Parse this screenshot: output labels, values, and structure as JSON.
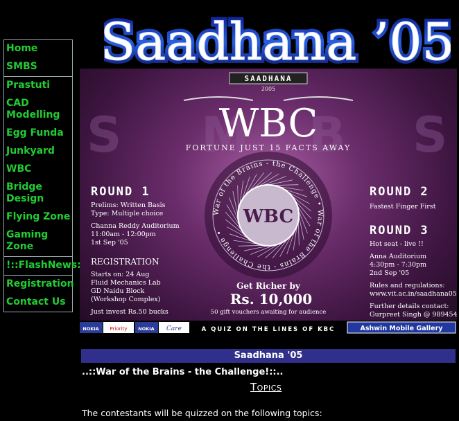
{
  "site": {
    "title": "Saadhana ’05"
  },
  "nav": {
    "groups": [
      [
        "Home",
        "SMBS"
      ],
      [
        "Prastuti",
        "CAD Modelling",
        "Egg Funda",
        "Junkyard",
        "WBC",
        "Bridge Design",
        "Flying Zone",
        "Gaming Zone"
      ],
      [
        "!::FlashNews::!"
      ],
      [
        "Registration",
        "Contact Us"
      ]
    ]
  },
  "banner": {
    "logo_text": "SAADHANA",
    "logo_year": "2005",
    "wbc": "WBC",
    "tagline": "FORTUNE JUST 15 FACTS AWAY",
    "bg_letters": [
      "S",
      "M",
      "B",
      "S"
    ],
    "circle_text": "War of the Brains - the Challenge • War of the Brains - the Challenge •",
    "center": "WBC",
    "round1": {
      "title": "ROUND 1",
      "lines": [
        "Prelims: Written Basis",
        "Type: Multiple choice",
        "",
        "Channa Reddy Auditorium",
        "11:00am - 12:00pm",
        "1st Sep '05"
      ]
    },
    "registration": {
      "title": "REGISTRATION",
      "lines": [
        "Starts on: 24 Aug",
        "Fluid Mechanics Lab",
        "GD Naidu Block",
        "(Workshop Complex)",
        "",
        "Just invest Rs.50 bucks"
      ]
    },
    "round2": {
      "title": "ROUND 2",
      "lines": [
        "Fastest Finger First"
      ]
    },
    "round3": {
      "title": "ROUND 3",
      "lines": [
        "Hot seat - live !!",
        "",
        "Anna Auditorium",
        "4:30pm - 7:30pm",
        "2nd Sep '05",
        "",
        "Rules and regulations:",
        "www.vit.ac.in/saadhana05",
        "",
        "Further details contact:",
        "Gurpreet Singh @ 9894548934"
      ]
    },
    "prize": {
      "line1": "Get Richer by",
      "amount": "Rs. 10,000",
      "line3": "50 gift vouchers awaiting for audience"
    },
    "footer": {
      "sponsor1": "NOKIA",
      "sponsor1b": "Priority",
      "sponsor2": "NOKIA",
      "sponsor2b": "Care",
      "tagline": "A QUIZ ON THE LINES OF KBC",
      "sponsor3": "Ashwin Mobile Gallery"
    }
  },
  "content": {
    "section_title": "Saadhana '05",
    "subtitle": "..::War of the Brains - the Challenge!::..",
    "topics_heading": "Topics",
    "topics_intro": "The contestants will be quizzed on the following topics:"
  },
  "colors": {
    "nav_link": "#22cc33",
    "section_header_bg": "#30308c",
    "banner_purple": "#6b2d6c"
  }
}
